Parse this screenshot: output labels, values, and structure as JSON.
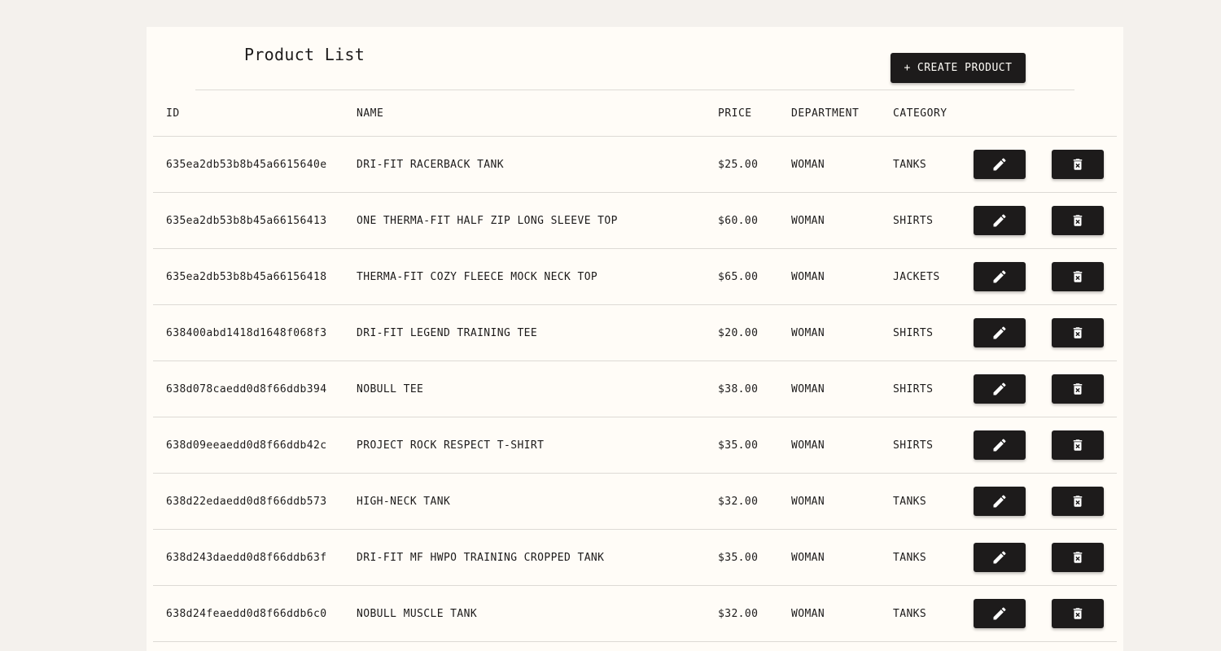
{
  "page": {
    "title": "Product List",
    "create_button": {
      "icon": "+",
      "label": "CREATE PRODUCT"
    }
  },
  "table": {
    "headers": {
      "id": "ID",
      "name": "NAME",
      "price": "PRICE",
      "department": "DEPARTMENT",
      "category": "CATEGORY"
    },
    "rows": [
      {
        "id": "635ea2db53b8b45a6615640e",
        "name": "DRI-FIT RACERBACK TANK",
        "price": "$25.00",
        "department": "WOMAN",
        "category": "TANKS"
      },
      {
        "id": "635ea2db53b8b45a66156413",
        "name": "ONE THERMA-FIT HALF ZIP LONG SLEEVE TOP",
        "price": "$60.00",
        "department": "WOMAN",
        "category": "SHIRTS"
      },
      {
        "id": "635ea2db53b8b45a66156418",
        "name": "THERMA-FIT COZY FLEECE MOCK NECK TOP",
        "price": "$65.00",
        "department": "WOMAN",
        "category": "JACKETS"
      },
      {
        "id": "638400abd1418d1648f068f3",
        "name": "DRI-FIT LEGEND TRAINING TEE",
        "price": "$20.00",
        "department": "WOMAN",
        "category": "SHIRTS"
      },
      {
        "id": "638d078caedd0d8f66ddb394",
        "name": "NOBULL TEE",
        "price": "$38.00",
        "department": "WOMAN",
        "category": "SHIRTS"
      },
      {
        "id": "638d09eeaedd0d8f66ddb42c",
        "name": "PROJECT ROCK RESPECT T-SHIRT",
        "price": "$35.00",
        "department": "WOMAN",
        "category": "SHIRTS"
      },
      {
        "id": "638d22edaedd0d8f66ddb573",
        "name": "HIGH-NECK TANK",
        "price": "$32.00",
        "department": "WOMAN",
        "category": "TANKS"
      },
      {
        "id": "638d243daedd0d8f66ddb63f",
        "name": "DRI-FIT MF HWPO TRAINING CROPPED TANK",
        "price": "$35.00",
        "department": "WOMAN",
        "category": "TANKS"
      },
      {
        "id": "638d24feaedd0d8f66ddb6c0",
        "name": "NOBULL MUSCLE TANK",
        "price": "$32.00",
        "department": "WOMAN",
        "category": "TANKS"
      }
    ],
    "row_actions": {
      "edit_icon": "pencil-icon",
      "delete_icon": "trash-icon"
    }
  },
  "colors": {
    "page_background": "#f4f1ed",
    "card_background": "#fffcf7",
    "button_background": "#1d1b1b",
    "button_text": "#fdfbf6",
    "divider": "#dddad5"
  }
}
